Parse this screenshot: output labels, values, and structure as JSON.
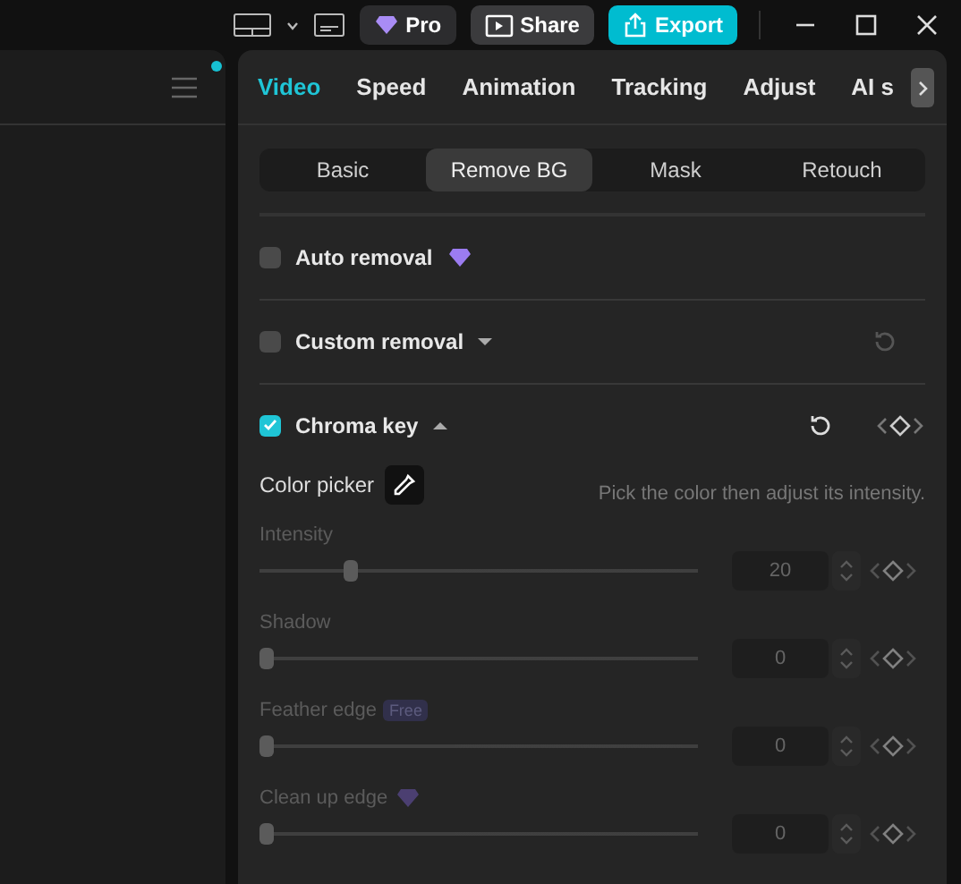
{
  "top_bar": {
    "pro_label": "Pro",
    "share_label": "Share",
    "export_label": "Export"
  },
  "left_panel": {
    "notification": true
  },
  "tabs": [
    {
      "label": "Video",
      "selected": true
    },
    {
      "label": "Speed",
      "selected": false
    },
    {
      "label": "Animation",
      "selected": false
    },
    {
      "label": "Tracking",
      "selected": false
    },
    {
      "label": "Adjust",
      "selected": false
    },
    {
      "label": "AI s",
      "selected": false
    }
  ],
  "sub_tabs": [
    {
      "label": "Basic",
      "selected": false
    },
    {
      "label": "Remove BG",
      "selected": true
    },
    {
      "label": "Mask",
      "selected": false
    },
    {
      "label": "Retouch",
      "selected": false
    }
  ],
  "sections": [
    {
      "kind": "premium",
      "label": "Auto removal",
      "checked": false
    },
    {
      "kind": "collapsible",
      "label": "Custom removal",
      "checked": false,
      "expanded": false
    },
    {
      "kind": "collapsible",
      "label": "Chroma key",
      "checked": true,
      "expanded": true
    }
  ],
  "color_picker": {
    "label": "Color picker",
    "hint": "Pick the color then adjust its intensity."
  },
  "sliders": [
    {
      "label": "Intensity",
      "level": 0.2,
      "value": "20",
      "disabled": true
    },
    {
      "label": "Shadow",
      "level": 0,
      "value": "0",
      "disabled": true
    },
    {
      "label": "Feather edge",
      "badge": "Free",
      "level": 0,
      "value": "0",
      "disabled": true
    },
    {
      "label": "Clean up edge",
      "premium": true,
      "level": 0,
      "value": "0",
      "disabled": true
    }
  ]
}
